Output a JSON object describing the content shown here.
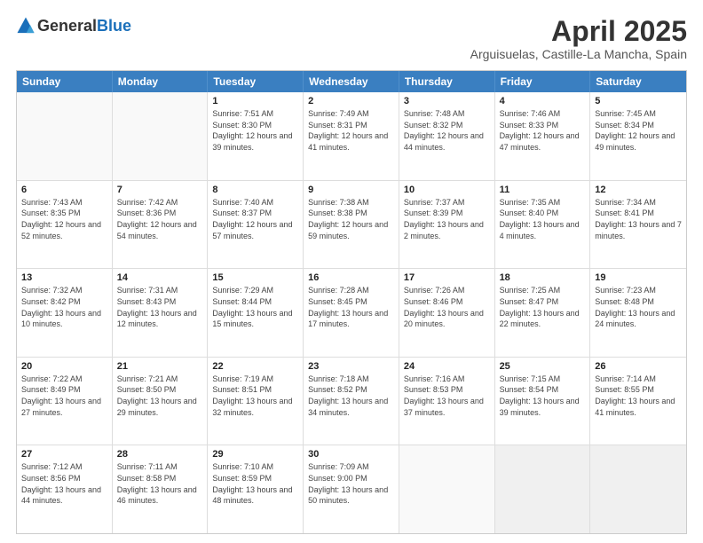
{
  "header": {
    "logo_general": "General",
    "logo_blue": "Blue",
    "title": "April 2025",
    "subtitle": "Arguisuelas, Castille-La Mancha, Spain"
  },
  "calendar": {
    "days": [
      "Sunday",
      "Monday",
      "Tuesday",
      "Wednesday",
      "Thursday",
      "Friday",
      "Saturday"
    ],
    "rows": [
      [
        {
          "day": "",
          "empty": true
        },
        {
          "day": "",
          "empty": true
        },
        {
          "day": "1",
          "sunrise": "7:51 AM",
          "sunset": "8:30 PM",
          "daylight": "12 hours and 39 minutes."
        },
        {
          "day": "2",
          "sunrise": "7:49 AM",
          "sunset": "8:31 PM",
          "daylight": "12 hours and 41 minutes."
        },
        {
          "day": "3",
          "sunrise": "7:48 AM",
          "sunset": "8:32 PM",
          "daylight": "12 hours and 44 minutes."
        },
        {
          "day": "4",
          "sunrise": "7:46 AM",
          "sunset": "8:33 PM",
          "daylight": "12 hours and 47 minutes."
        },
        {
          "day": "5",
          "sunrise": "7:45 AM",
          "sunset": "8:34 PM",
          "daylight": "12 hours and 49 minutes."
        }
      ],
      [
        {
          "day": "6",
          "sunrise": "7:43 AM",
          "sunset": "8:35 PM",
          "daylight": "12 hours and 52 minutes."
        },
        {
          "day": "7",
          "sunrise": "7:42 AM",
          "sunset": "8:36 PM",
          "daylight": "12 hours and 54 minutes."
        },
        {
          "day": "8",
          "sunrise": "7:40 AM",
          "sunset": "8:37 PM",
          "daylight": "12 hours and 57 minutes."
        },
        {
          "day": "9",
          "sunrise": "7:38 AM",
          "sunset": "8:38 PM",
          "daylight": "12 hours and 59 minutes."
        },
        {
          "day": "10",
          "sunrise": "7:37 AM",
          "sunset": "8:39 PM",
          "daylight": "13 hours and 2 minutes."
        },
        {
          "day": "11",
          "sunrise": "7:35 AM",
          "sunset": "8:40 PM",
          "daylight": "13 hours and 4 minutes."
        },
        {
          "day": "12",
          "sunrise": "7:34 AM",
          "sunset": "8:41 PM",
          "daylight": "13 hours and 7 minutes."
        }
      ],
      [
        {
          "day": "13",
          "sunrise": "7:32 AM",
          "sunset": "8:42 PM",
          "daylight": "13 hours and 10 minutes."
        },
        {
          "day": "14",
          "sunrise": "7:31 AM",
          "sunset": "8:43 PM",
          "daylight": "13 hours and 12 minutes."
        },
        {
          "day": "15",
          "sunrise": "7:29 AM",
          "sunset": "8:44 PM",
          "daylight": "13 hours and 15 minutes."
        },
        {
          "day": "16",
          "sunrise": "7:28 AM",
          "sunset": "8:45 PM",
          "daylight": "13 hours and 17 minutes."
        },
        {
          "day": "17",
          "sunrise": "7:26 AM",
          "sunset": "8:46 PM",
          "daylight": "13 hours and 20 minutes."
        },
        {
          "day": "18",
          "sunrise": "7:25 AM",
          "sunset": "8:47 PM",
          "daylight": "13 hours and 22 minutes."
        },
        {
          "day": "19",
          "sunrise": "7:23 AM",
          "sunset": "8:48 PM",
          "daylight": "13 hours and 24 minutes."
        }
      ],
      [
        {
          "day": "20",
          "sunrise": "7:22 AM",
          "sunset": "8:49 PM",
          "daylight": "13 hours and 27 minutes."
        },
        {
          "day": "21",
          "sunrise": "7:21 AM",
          "sunset": "8:50 PM",
          "daylight": "13 hours and 29 minutes."
        },
        {
          "day": "22",
          "sunrise": "7:19 AM",
          "sunset": "8:51 PM",
          "daylight": "13 hours and 32 minutes."
        },
        {
          "day": "23",
          "sunrise": "7:18 AM",
          "sunset": "8:52 PM",
          "daylight": "13 hours and 34 minutes."
        },
        {
          "day": "24",
          "sunrise": "7:16 AM",
          "sunset": "8:53 PM",
          "daylight": "13 hours and 37 minutes."
        },
        {
          "day": "25",
          "sunrise": "7:15 AM",
          "sunset": "8:54 PM",
          "daylight": "13 hours and 39 minutes."
        },
        {
          "day": "26",
          "sunrise": "7:14 AM",
          "sunset": "8:55 PM",
          "daylight": "13 hours and 41 minutes."
        }
      ],
      [
        {
          "day": "27",
          "sunrise": "7:12 AM",
          "sunset": "8:56 PM",
          "daylight": "13 hours and 44 minutes."
        },
        {
          "day": "28",
          "sunrise": "7:11 AM",
          "sunset": "8:58 PM",
          "daylight": "13 hours and 46 minutes."
        },
        {
          "day": "29",
          "sunrise": "7:10 AM",
          "sunset": "8:59 PM",
          "daylight": "13 hours and 48 minutes."
        },
        {
          "day": "30",
          "sunrise": "7:09 AM",
          "sunset": "9:00 PM",
          "daylight": "13 hours and 50 minutes."
        },
        {
          "day": "",
          "empty": true
        },
        {
          "day": "",
          "empty": true,
          "shaded": true
        },
        {
          "day": "",
          "empty": true,
          "shaded": true
        }
      ]
    ]
  }
}
